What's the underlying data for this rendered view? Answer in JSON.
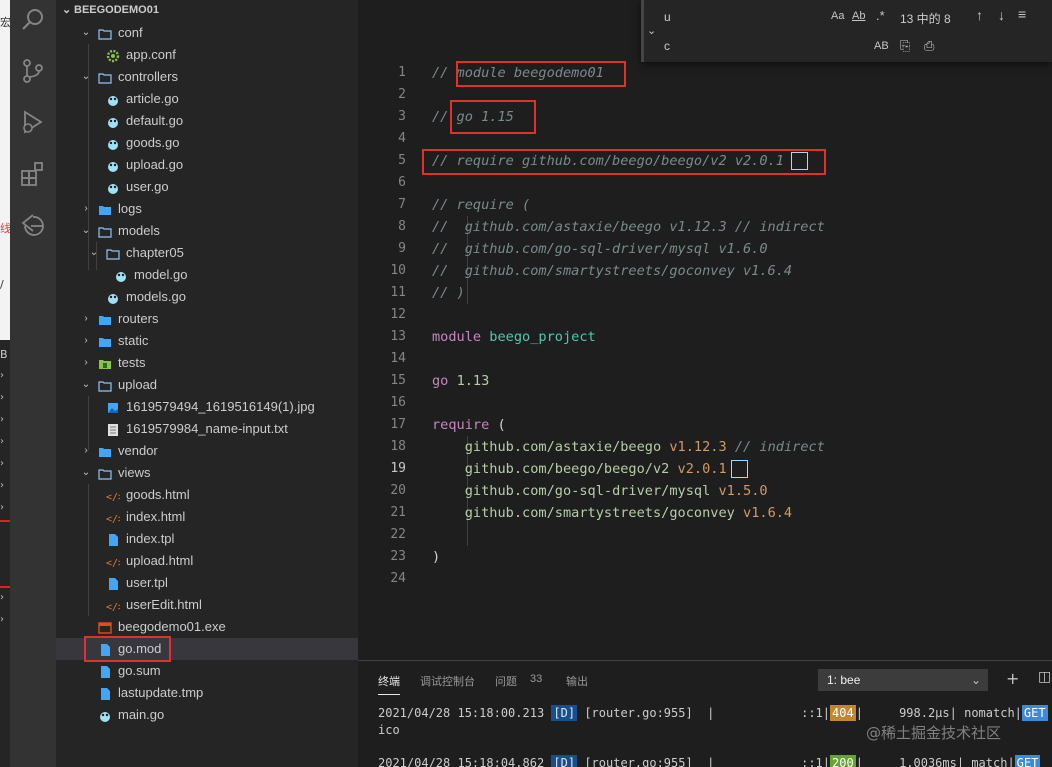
{
  "left_strip": {
    "chars": [
      "宏",
      "8",
      "线",
      "/",
      "B"
    ]
  },
  "explorer": {
    "root_label": "BEEGODEMO01",
    "rows": [
      {
        "label": "conf",
        "kind": "folder-open",
        "depth": 1
      },
      {
        "label": "app.conf",
        "kind": "settings-file",
        "depth": 2
      },
      {
        "label": "controllers",
        "kind": "folder-open",
        "depth": 1
      },
      {
        "label": "article.go",
        "kind": "go-file",
        "depth": 2
      },
      {
        "label": "default.go",
        "kind": "go-file",
        "depth": 2
      },
      {
        "label": "goods.go",
        "kind": "go-file",
        "depth": 2
      },
      {
        "label": "upload.go",
        "kind": "go-file",
        "depth": 2
      },
      {
        "label": "user.go",
        "kind": "go-file",
        "depth": 2
      },
      {
        "label": "logs",
        "kind": "folder-closed",
        "depth": 1
      },
      {
        "label": "models",
        "kind": "folder-open",
        "depth": 1
      },
      {
        "label": "chapter05",
        "kind": "folder-open",
        "depth": 2
      },
      {
        "label": "model.go",
        "kind": "go-file",
        "depth": 3
      },
      {
        "label": "models.go",
        "kind": "go-file",
        "depth": 2
      },
      {
        "label": "routers",
        "kind": "folder-closed",
        "depth": 1
      },
      {
        "label": "static",
        "kind": "folder-closed",
        "depth": 1
      },
      {
        "label": "tests",
        "kind": "folder-tests",
        "depth": 1
      },
      {
        "label": "upload",
        "kind": "folder-open",
        "depth": 1
      },
      {
        "label": "1619579494_1619516149(1).jpg",
        "kind": "image-file",
        "depth": 2
      },
      {
        "label": "1619579984_name-input.txt",
        "kind": "text-file",
        "depth": 2
      },
      {
        "label": "vendor",
        "kind": "folder-closed",
        "depth": 1
      },
      {
        "label": "views",
        "kind": "folder-open",
        "depth": 1
      },
      {
        "label": "goods.html",
        "kind": "html-file",
        "depth": 2
      },
      {
        "label": "index.html",
        "kind": "html-file",
        "depth": 2
      },
      {
        "label": "index.tpl",
        "kind": "doc-file",
        "depth": 2
      },
      {
        "label": "upload.html",
        "kind": "html-file",
        "depth": 2
      },
      {
        "label": "user.tpl",
        "kind": "doc-file",
        "depth": 2
      },
      {
        "label": "userEdit.html",
        "kind": "html-file",
        "depth": 2
      },
      {
        "label": "beegodemo01.exe",
        "kind": "exe-file",
        "depth": 1
      },
      {
        "label": "go.mod",
        "kind": "doc-file",
        "depth": 1,
        "selected": true
      },
      {
        "label": "go.sum",
        "kind": "doc-file",
        "depth": 1
      },
      {
        "label": "lastupdate.tmp",
        "kind": "doc-file",
        "depth": 1
      },
      {
        "label": "main.go",
        "kind": "go-file",
        "depth": 1
      }
    ]
  },
  "find_widget": {
    "find_value": "u",
    "replace_value": "c",
    "match_case": "Aa",
    "whole_word": "Ab",
    "regex": ".*",
    "result_count": "13 中的 8",
    "preserve_case": "AB"
  },
  "editor": {
    "active_line": 19,
    "lines": [
      {
        "n": "1",
        "text": "// module beegodemo01"
      },
      {
        "n": "2",
        "text": ""
      },
      {
        "n": "3",
        "text": "// go 1.15"
      },
      {
        "n": "4",
        "text": ""
      },
      {
        "n": "5",
        "text": "// require github.com/beego/beego/v2 v2.0.1"
      },
      {
        "n": "6",
        "text": ""
      },
      {
        "n": "7",
        "text": "// require ("
      },
      {
        "n": "8",
        "text": "//  github.com/astaxie/beego v1.12.3 // indirect"
      },
      {
        "n": "9",
        "text": "//  github.com/go-sql-driver/mysql v1.6.0"
      },
      {
        "n": "10",
        "text": "//  github.com/smartystreets/goconvey v1.6.4"
      },
      {
        "n": "11",
        "text": "// )"
      },
      {
        "n": "12",
        "text": ""
      },
      {
        "n": "13",
        "keyword": "module",
        "ident": "beego_project"
      },
      {
        "n": "14",
        "text": ""
      },
      {
        "n": "15",
        "keyword": "go",
        "version": "1.13"
      },
      {
        "n": "16",
        "text": ""
      },
      {
        "n": "17",
        "keyword": "require",
        "punct": "("
      },
      {
        "n": "18",
        "pkg": "github.com/astaxie/beego",
        "version": "v1.12.3",
        "comment": "// indirect"
      },
      {
        "n": "19",
        "pkg": "github.com/beego/beego/v2",
        "version": "v2.0.1"
      },
      {
        "n": "20",
        "pkg": "github.com/go-sql-driver/mysql",
        "version": "v1.5.0"
      },
      {
        "n": "21",
        "pkg": "github.com/smartystreets/goconvey",
        "version": "v1.6.4"
      },
      {
        "n": "22",
        "text": ""
      },
      {
        "n": "23",
        "text": ")"
      },
      {
        "n": "24",
        "text": ""
      }
    ]
  },
  "panel": {
    "tabs": [
      "终端",
      "调试控制台",
      "问题",
      "输出"
    ],
    "problems_count": "33",
    "terminal_select": "1: bee",
    "lines": [
      {
        "time": "2021/04/28 15:18:00.213",
        "level": "[D]",
        "src": "[router.go:955]",
        "sep": "|",
        "addr": "::1",
        "status": "404",
        "dur": "998.2µs",
        "match": "nomatch",
        "method": "GET"
      },
      {
        "text": "ico"
      },
      {
        "time": "2021/04/28 15:18:04.862",
        "level": "[D]",
        "src": "[router.go:955]",
        "sep": "|",
        "addr": "::1",
        "status": "200",
        "dur": "1.0036ms",
        "match": "match",
        "method": "GET"
      }
    ]
  },
  "watermark": "@稀土掘金技术社区",
  "colors": {
    "comment": "#6a9955",
    "keyword": "#c586c0",
    "ident": "#4ec9b0",
    "package": "#b5cea8",
    "version": "#d19a66",
    "highlight_box": "#e0312d"
  }
}
